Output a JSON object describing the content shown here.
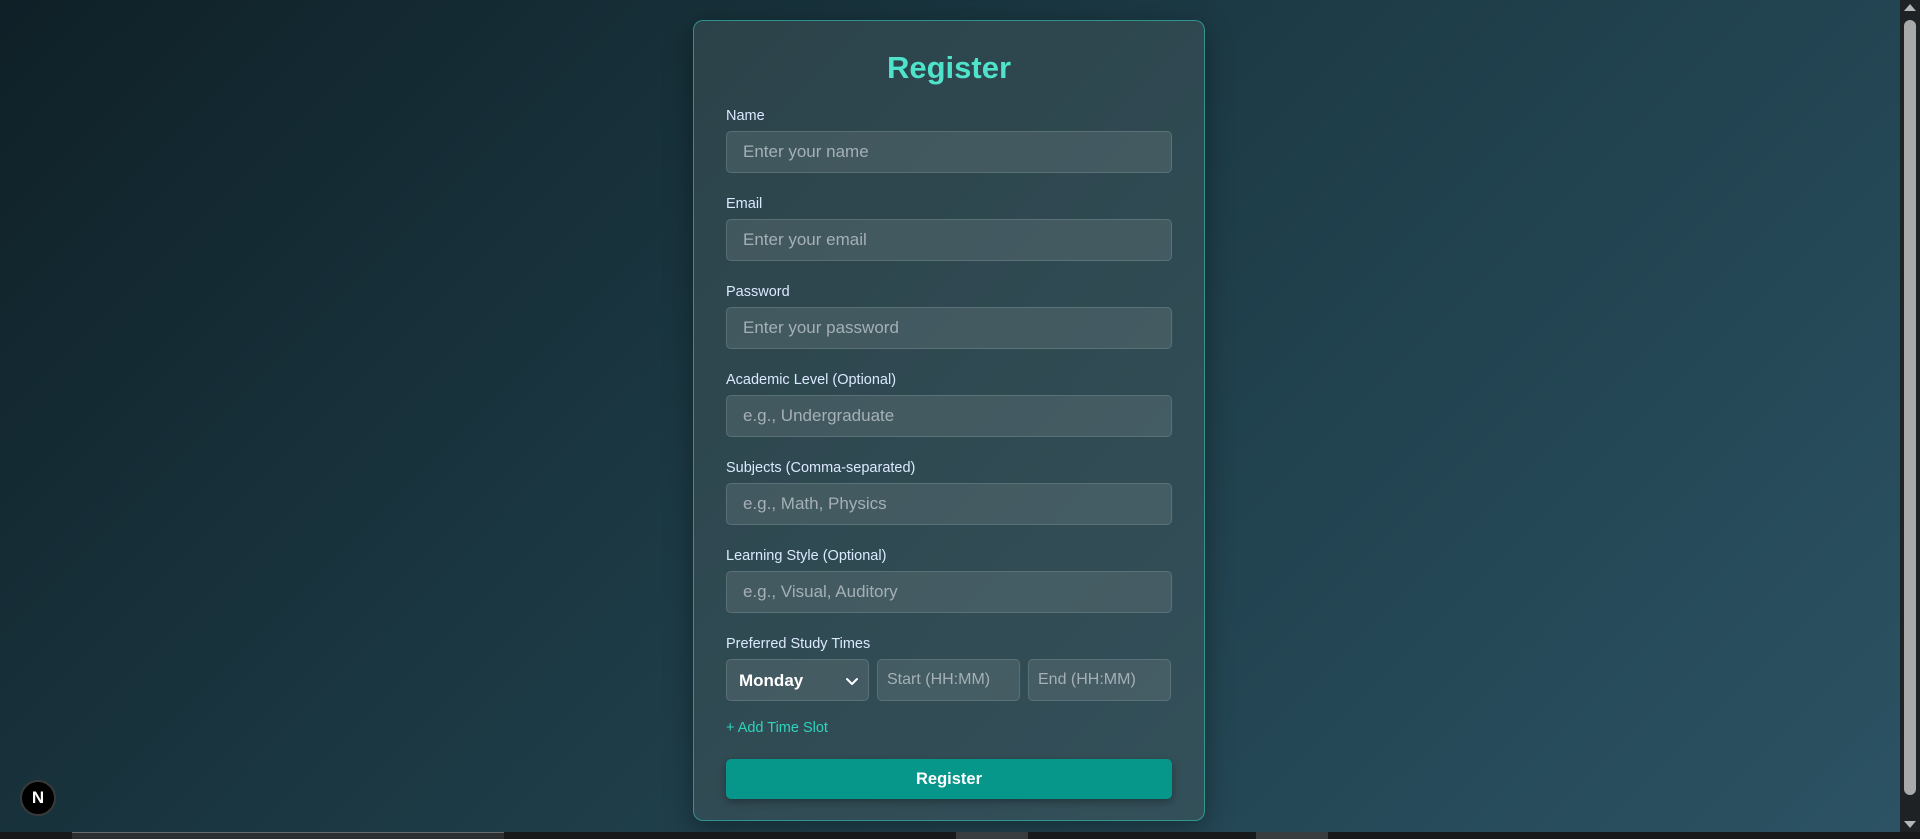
{
  "form": {
    "title": "Register",
    "fields": [
      {
        "label": "Name",
        "placeholder": "Enter your name",
        "value": ""
      },
      {
        "label": "Email",
        "placeholder": "Enter your email",
        "value": ""
      },
      {
        "label": "Password",
        "placeholder": "Enter your password",
        "value": ""
      },
      {
        "label": "Academic Level (Optional)",
        "placeholder": "e.g., Undergraduate",
        "value": ""
      },
      {
        "label": "Subjects (Comma-separated)",
        "placeholder": "e.g., Math, Physics",
        "value": ""
      },
      {
        "label": "Learning Style (Optional)",
        "placeholder": "e.g., Visual, Auditory",
        "value": ""
      }
    ],
    "study_times": {
      "label": "Preferred Study Times",
      "day_selected": "Monday",
      "start_placeholder": "Start (HH:MM)",
      "end_placeholder": "End (HH:MM)"
    },
    "add_slot_label": "+ Add Time Slot",
    "submit_label": "Register"
  },
  "badge": {
    "letter": "N",
    "icon": "nextjs-logo-icon"
  },
  "colors": {
    "accent": "#4fe3cc",
    "button": "#06968a",
    "link": "#2dd4bf"
  }
}
